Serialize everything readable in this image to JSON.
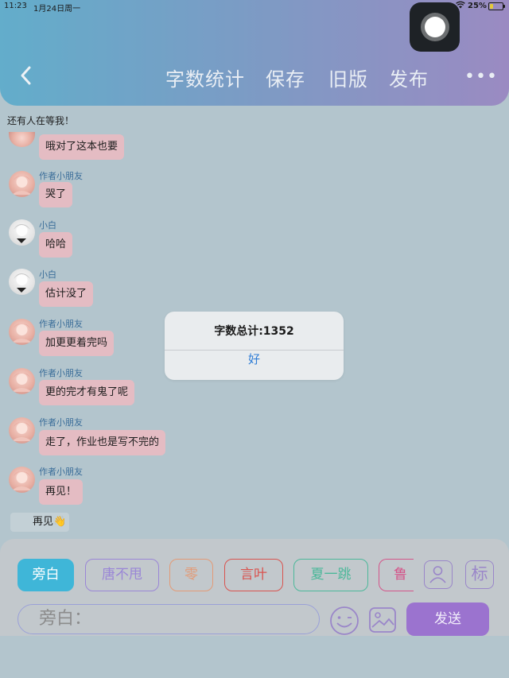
{
  "status_bar": {
    "time": "11:23",
    "date": "1月24日周一",
    "battery": "25%",
    "battery_level": 0.25
  },
  "header": {
    "nav": {
      "word_count": "字数统计",
      "save": "保存",
      "old_version": "旧版",
      "publish": "发布"
    }
  },
  "chat": {
    "top_text": "还有人在等我！",
    "messages": [
      {
        "sender": "",
        "text": "哦对了这本也要"
      },
      {
        "sender": "作者小朋友",
        "text": "哭了"
      },
      {
        "sender": "小白",
        "text": "哈哈"
      },
      {
        "sender": "小白",
        "text": "估计没了"
      },
      {
        "sender": "作者小朋友",
        "text": "加更更着完吗"
      },
      {
        "sender": "作者小朋友",
        "text": "更的完才有鬼了呢"
      },
      {
        "sender": "作者小朋友",
        "text": "走了，作业也是写不完的"
      },
      {
        "sender": "作者小朋友",
        "text": "再见！"
      }
    ],
    "narration": "再见👋"
  },
  "roles": [
    {
      "label": "旁白",
      "color": "#3fb6d8"
    },
    {
      "label": "唐不甩",
      "color": "#9a86d6"
    },
    {
      "label": "零",
      "color": "#e39a76"
    },
    {
      "label": "言叶",
      "color": "#d9534f"
    },
    {
      "label": "夏一跳",
      "color": "#4cb89a"
    },
    {
      "label": "鲁",
      "color": "#d4558a"
    }
  ],
  "tools": {
    "label_button": "标"
  },
  "input": {
    "placeholder": "旁白："
  },
  "send_label": "发送",
  "dialog": {
    "message": "字数总计:1352",
    "ok": "好"
  }
}
